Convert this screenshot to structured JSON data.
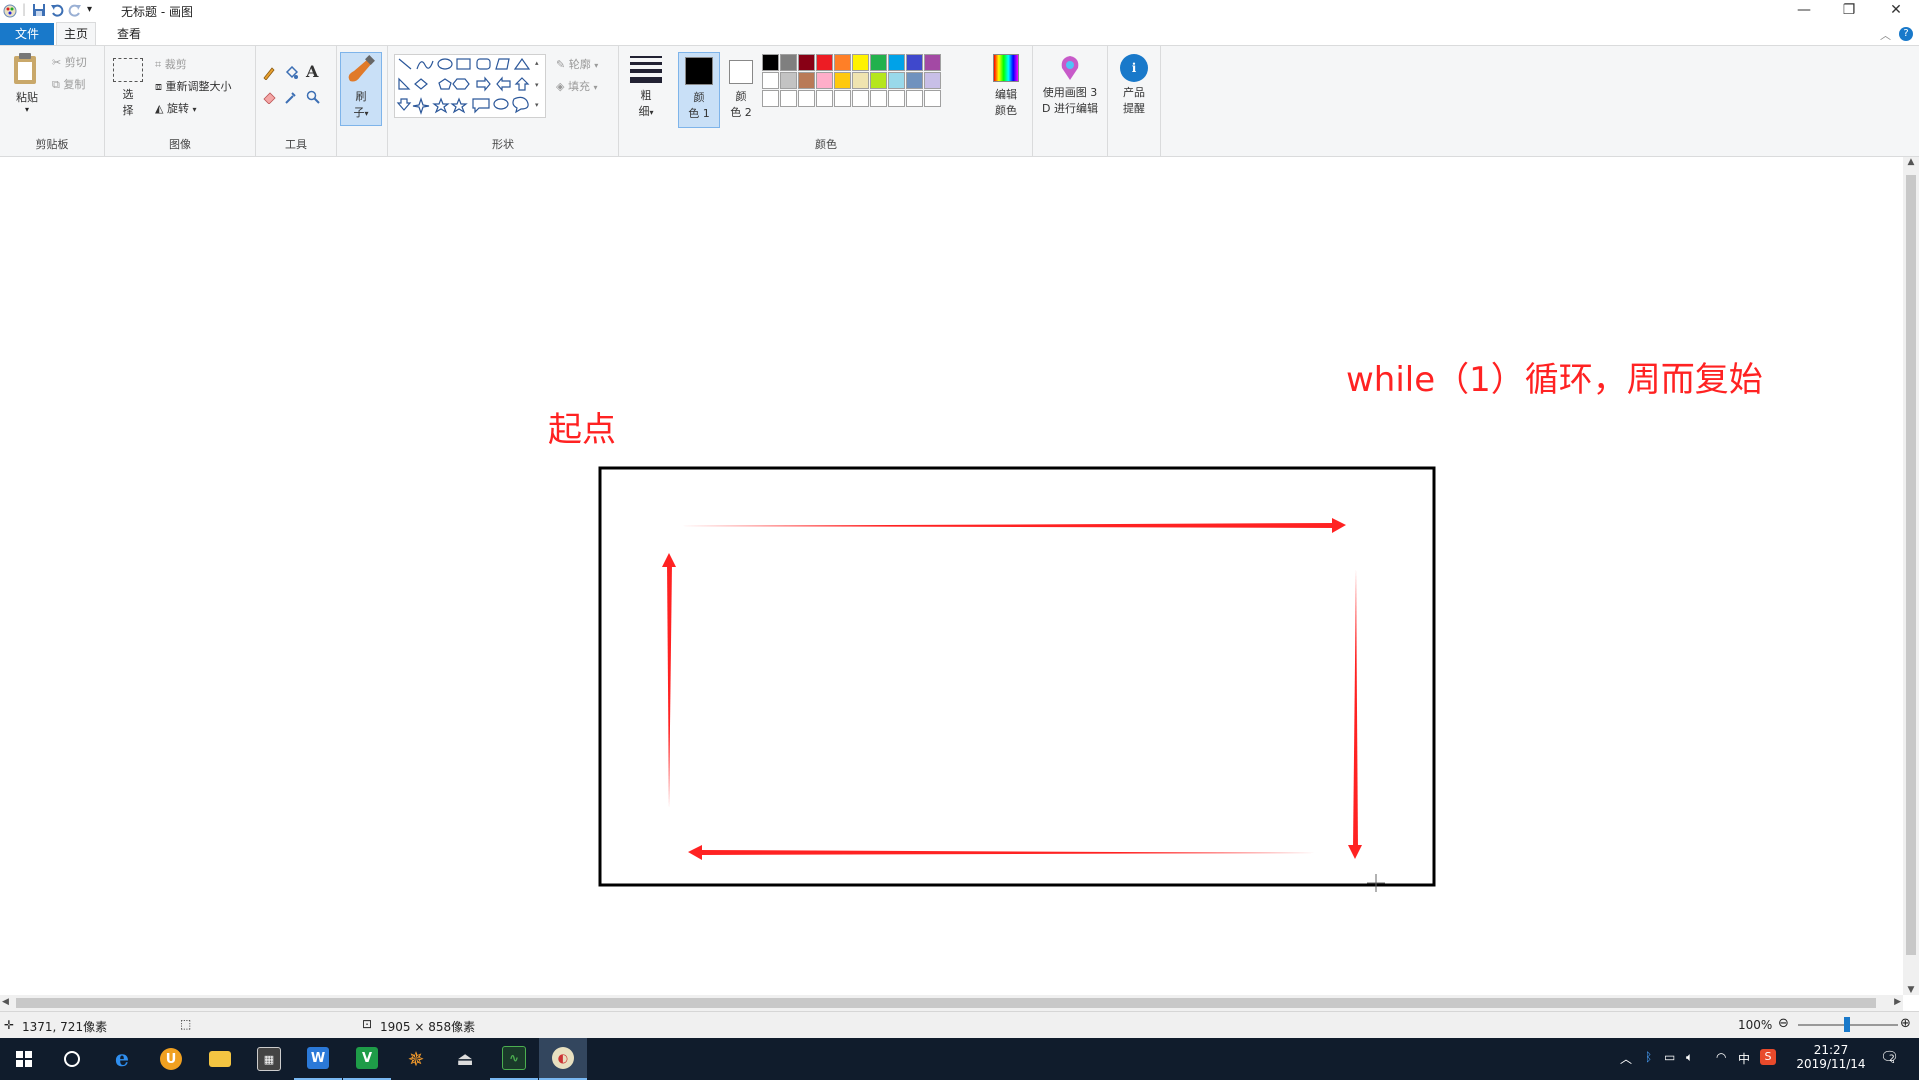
{
  "window": {
    "title": "无标题 - 画图",
    "controls": {
      "minimize": "—",
      "restore": "❐",
      "close": "✕"
    }
  },
  "tabs": [
    {
      "label": "文件",
      "active": false
    },
    {
      "label": "主页",
      "active": true
    },
    {
      "label": "查看",
      "active": false
    }
  ],
  "ribbon": {
    "clipboard": {
      "paste": "粘贴",
      "cut": "剪切",
      "copy": "复制",
      "group_label": "剪贴板"
    },
    "image": {
      "select_line1": "选",
      "select_line2": "择",
      "crop": "裁剪",
      "resize": "重新调整大小",
      "rotate": "旋转",
      "group_label": "图像"
    },
    "tools": {
      "group_label": "工具",
      "text_tool": "A"
    },
    "brushes": {
      "line1": "刷",
      "line2": "子"
    },
    "shapes": {
      "outline": "轮廓",
      "fill": "填充",
      "group_label": "形状"
    },
    "size": {
      "line1": "粗",
      "line2": "细"
    },
    "color1": {
      "line1": "颜",
      "line2": "色 1",
      "value": "#000000"
    },
    "color2": {
      "line1": "颜",
      "line2": "色 2",
      "value": "#ffffff"
    },
    "colors": {
      "group_label": "颜色",
      "palette_row1": [
        "#000000",
        "#7f7f7f",
        "#880015",
        "#ed1c24",
        "#ff7f27",
        "#fff200",
        "#22b14c",
        "#00a2e8",
        "#3f48cc",
        "#a349a4"
      ],
      "palette_row2": [
        "#ffffff",
        "#c3c3c3",
        "#b97a57",
        "#ffaec9",
        "#ffc90e",
        "#efe4b0",
        "#b5e61d",
        "#99d9ea",
        "#7092be",
        "#c8bfe7"
      ],
      "edit_colors_line1": "编辑",
      "edit_colors_line2": "颜色"
    },
    "paint3d": {
      "line1": "使用画图 3",
      "line2": "D 进行编辑"
    },
    "product_alert": {
      "line1": "产品",
      "line2": "提醒"
    }
  },
  "canvas": {
    "annotation_start": "起点",
    "annotation_loop": "while（1）循环，周而复始",
    "annotation_color": "#ff0000"
  },
  "status": {
    "cursor_pos": "1371, 721像素",
    "image_size": "1905 × 858像素",
    "zoom": "100%"
  },
  "taskbar": {
    "apps": [
      "start-icon",
      "cortana-icon",
      "edge-icon",
      "ucbrowser-icon",
      "explorer-icon",
      "calculator-icon",
      "wps-writer-icon",
      "wps-sheet-icon",
      "settings-app-icon",
      "printer-app-icon",
      "task-manager-icon",
      "paint-icon"
    ],
    "time": "21:27",
    "date": "2019/11/14",
    "ime": "中",
    "notification_count": "2"
  }
}
